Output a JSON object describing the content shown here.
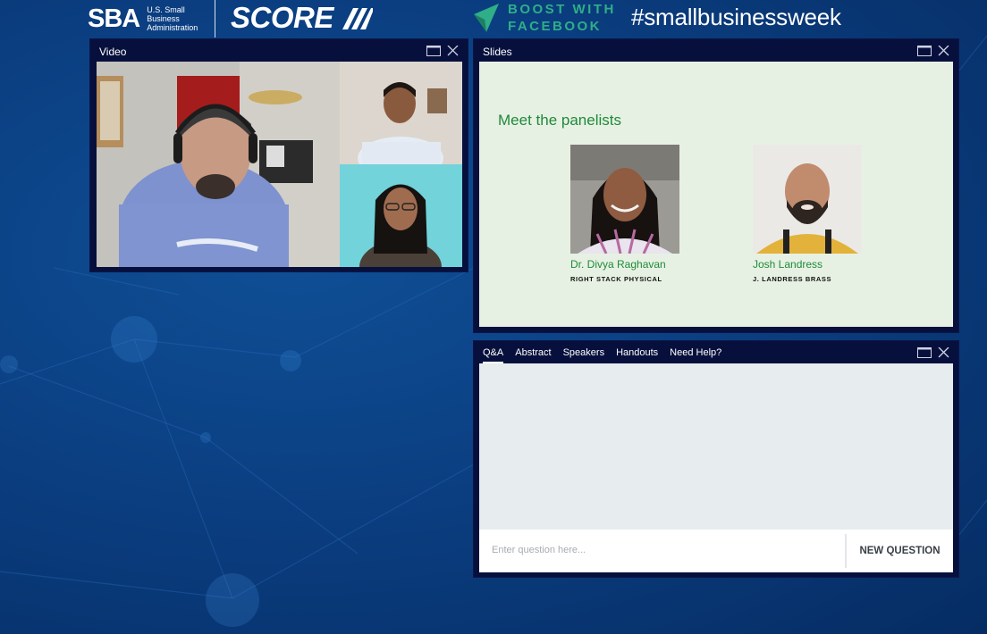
{
  "header": {
    "sba_mark": "SBA",
    "sba_text": "U.S. Small Business Administration",
    "score_logo": "SCORE",
    "boost_text_line1": "BOOST WITH",
    "boost_text_line2": "FACEBOOK",
    "hashtag": "#smallbusinessweek"
  },
  "video_panel": {
    "title": "Video"
  },
  "slides_panel": {
    "title": "Slides",
    "heading": "Meet the panelists",
    "panelists": [
      {
        "name": "Dr. Divya Raghavan",
        "company": "RIGHT STACK PHYSICAL"
      },
      {
        "name": "Josh Landress",
        "company": "J. LANDRESS BRASS"
      }
    ]
  },
  "qa_panel": {
    "tabs": [
      {
        "label": "Q&A",
        "active": true
      },
      {
        "label": "Abstract",
        "active": false
      },
      {
        "label": "Speakers",
        "active": false
      },
      {
        "label": "Handouts",
        "active": false
      },
      {
        "label": "Need Help?",
        "active": false
      }
    ],
    "input_placeholder": "Enter question here...",
    "button_label": "NEW QUESTION"
  },
  "icons": {
    "maximize": "maximize-icon",
    "close": "close-icon"
  },
  "colors": {
    "background": "#0b3f82",
    "panel": "#07103d",
    "slide_bg": "#e7f1e3",
    "slide_accent": "#1f8a3a",
    "qa_body": "#e7ecef",
    "boost_green": "#2fae88"
  }
}
